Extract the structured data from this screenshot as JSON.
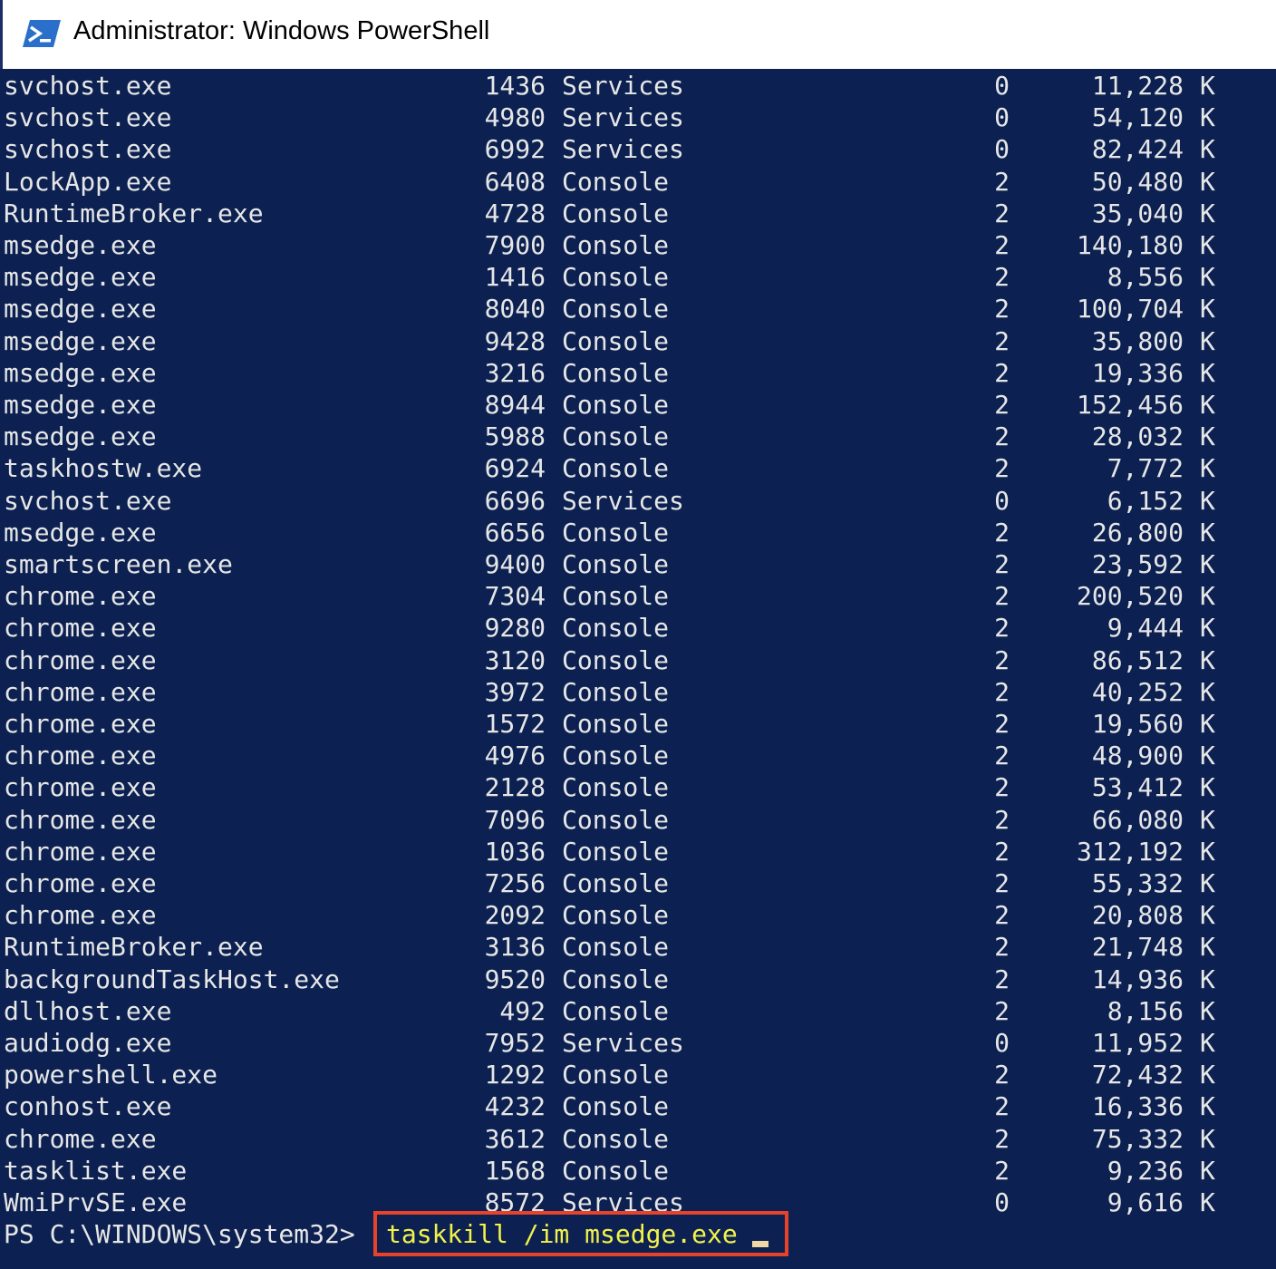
{
  "window": {
    "title": "Administrator: Windows PowerShell",
    "icon": "powershell-icon",
    "console_bg": "#0c2151",
    "text_color": "#e6e6e6",
    "command_color": "#f2f24b",
    "highlight_color": "#e8432a"
  },
  "rows": [
    {
      "name": "svchost.exe",
      "pid": "1436",
      "session": "Services",
      "num": "0",
      "mem": "11,228",
      "unit": "K"
    },
    {
      "name": "svchost.exe",
      "pid": "4980",
      "session": "Services",
      "num": "0",
      "mem": "54,120",
      "unit": "K"
    },
    {
      "name": "svchost.exe",
      "pid": "6992",
      "session": "Services",
      "num": "0",
      "mem": "82,424",
      "unit": "K"
    },
    {
      "name": "LockApp.exe",
      "pid": "6408",
      "session": "Console",
      "num": "2",
      "mem": "50,480",
      "unit": "K"
    },
    {
      "name": "RuntimeBroker.exe",
      "pid": "4728",
      "session": "Console",
      "num": "2",
      "mem": "35,040",
      "unit": "K"
    },
    {
      "name": "msedge.exe",
      "pid": "7900",
      "session": "Console",
      "num": "2",
      "mem": "140,180",
      "unit": "K"
    },
    {
      "name": "msedge.exe",
      "pid": "1416",
      "session": "Console",
      "num": "2",
      "mem": "8,556",
      "unit": "K"
    },
    {
      "name": "msedge.exe",
      "pid": "8040",
      "session": "Console",
      "num": "2",
      "mem": "100,704",
      "unit": "K"
    },
    {
      "name": "msedge.exe",
      "pid": "9428",
      "session": "Console",
      "num": "2",
      "mem": "35,800",
      "unit": "K"
    },
    {
      "name": "msedge.exe",
      "pid": "3216",
      "session": "Console",
      "num": "2",
      "mem": "19,336",
      "unit": "K"
    },
    {
      "name": "msedge.exe",
      "pid": "8944",
      "session": "Console",
      "num": "2",
      "mem": "152,456",
      "unit": "K"
    },
    {
      "name": "msedge.exe",
      "pid": "5988",
      "session": "Console",
      "num": "2",
      "mem": "28,032",
      "unit": "K"
    },
    {
      "name": "taskhostw.exe",
      "pid": "6924",
      "session": "Console",
      "num": "2",
      "mem": "7,772",
      "unit": "K"
    },
    {
      "name": "svchost.exe",
      "pid": "6696",
      "session": "Services",
      "num": "0",
      "mem": "6,152",
      "unit": "K"
    },
    {
      "name": "msedge.exe",
      "pid": "6656",
      "session": "Console",
      "num": "2",
      "mem": "26,800",
      "unit": "K"
    },
    {
      "name": "smartscreen.exe",
      "pid": "9400",
      "session": "Console",
      "num": "2",
      "mem": "23,592",
      "unit": "K"
    },
    {
      "name": "chrome.exe",
      "pid": "7304",
      "session": "Console",
      "num": "2",
      "mem": "200,520",
      "unit": "K"
    },
    {
      "name": "chrome.exe",
      "pid": "9280",
      "session": "Console",
      "num": "2",
      "mem": "9,444",
      "unit": "K"
    },
    {
      "name": "chrome.exe",
      "pid": "3120",
      "session": "Console",
      "num": "2",
      "mem": "86,512",
      "unit": "K"
    },
    {
      "name": "chrome.exe",
      "pid": "3972",
      "session": "Console",
      "num": "2",
      "mem": "40,252",
      "unit": "K"
    },
    {
      "name": "chrome.exe",
      "pid": "1572",
      "session": "Console",
      "num": "2",
      "mem": "19,560",
      "unit": "K"
    },
    {
      "name": "chrome.exe",
      "pid": "4976",
      "session": "Console",
      "num": "2",
      "mem": "48,900",
      "unit": "K"
    },
    {
      "name": "chrome.exe",
      "pid": "2128",
      "session": "Console",
      "num": "2",
      "mem": "53,412",
      "unit": "K"
    },
    {
      "name": "chrome.exe",
      "pid": "7096",
      "session": "Console",
      "num": "2",
      "mem": "66,080",
      "unit": "K"
    },
    {
      "name": "chrome.exe",
      "pid": "1036",
      "session": "Console",
      "num": "2",
      "mem": "312,192",
      "unit": "K"
    },
    {
      "name": "chrome.exe",
      "pid": "7256",
      "session": "Console",
      "num": "2",
      "mem": "55,332",
      "unit": "K"
    },
    {
      "name": "chrome.exe",
      "pid": "2092",
      "session": "Console",
      "num": "2",
      "mem": "20,808",
      "unit": "K"
    },
    {
      "name": "RuntimeBroker.exe",
      "pid": "3136",
      "session": "Console",
      "num": "2",
      "mem": "21,748",
      "unit": "K"
    },
    {
      "name": "backgroundTaskHost.exe",
      "pid": "9520",
      "session": "Console",
      "num": "2",
      "mem": "14,936",
      "unit": "K"
    },
    {
      "name": "dllhost.exe",
      "pid": "492",
      "session": "Console",
      "num": "2",
      "mem": "8,156",
      "unit": "K"
    },
    {
      "name": "audiodg.exe",
      "pid": "7952",
      "session": "Services",
      "num": "0",
      "mem": "11,952",
      "unit": "K"
    },
    {
      "name": "powershell.exe",
      "pid": "1292",
      "session": "Console",
      "num": "2",
      "mem": "72,432",
      "unit": "K"
    },
    {
      "name": "conhost.exe",
      "pid": "4232",
      "session": "Console",
      "num": "2",
      "mem": "16,336",
      "unit": "K"
    },
    {
      "name": "chrome.exe",
      "pid": "3612",
      "session": "Console",
      "num": "2",
      "mem": "75,332",
      "unit": "K"
    },
    {
      "name": "tasklist.exe",
      "pid": "1568",
      "session": "Console",
      "num": "2",
      "mem": "9,236",
      "unit": "K"
    },
    {
      "name": "WmiPrvSE.exe",
      "pid": "8572",
      "session": "Services",
      "num": "0",
      "mem": "9,616",
      "unit": "K"
    }
  ],
  "prompt": {
    "text": "PS C:\\WINDOWS\\system32>",
    "command": "taskkill /im msedge.exe"
  }
}
